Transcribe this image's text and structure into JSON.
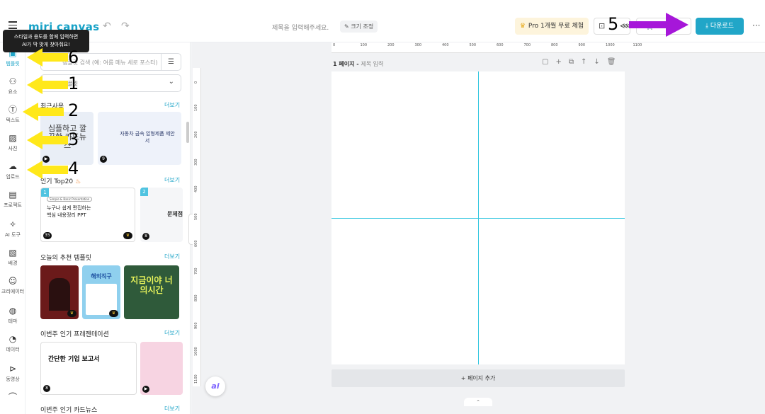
{
  "topbar": {
    "logo": "miri canvas",
    "undo_icon": "undo-icon",
    "redo_icon": "redo-icon",
    "doc_title_placeholder": "제목을 입력해주세요.",
    "resize_label": "크기 조정",
    "pro_trial_label": "Pro 1개월 무료 체험",
    "download_label": "다운로드",
    "more_label": "···"
  },
  "tooltip": {
    "line1": "스타일과 용도를 함께 입력하면",
    "line2": "AI가 딱 맞게 찾아줘요!"
  },
  "rail": {
    "items": [
      {
        "label": "템플릿",
        "icon": "template-icon"
      },
      {
        "label": "요소",
        "icon": "elements-icon"
      },
      {
        "label": "텍스트",
        "icon": "text-icon"
      },
      {
        "label": "사진",
        "icon": "photo-icon"
      },
      {
        "label": "업로드",
        "icon": "upload-icon"
      },
      {
        "label": "프로젝트",
        "icon": "project-icon"
      },
      {
        "label": "AI 도구",
        "icon": "ai-tools-icon"
      },
      {
        "label": "배경",
        "icon": "background-icon"
      },
      {
        "label": "크리에이터",
        "icon": "creator-icon"
      },
      {
        "label": "테마",
        "icon": "theme-icon"
      },
      {
        "label": "데이터",
        "icon": "data-icon"
      },
      {
        "label": "동영상",
        "icon": "video-icon"
      }
    ]
  },
  "panel": {
    "search_placeholder": "템플릿 검색 (예: 여름 메뉴 세로 포스터)",
    "select_value": "템플릿",
    "recent_title": "최근사용",
    "more_label": "더보기",
    "recent_thumbs": [
      {
        "title": "심플하고 깔끔한 카드뉴스",
        "count": ""
      },
      {
        "title": "자동차 금속 압형제품 제안서",
        "count": "9"
      }
    ],
    "top20_title": "인기 Top20",
    "top20_thumbs": [
      {
        "rank": "1",
        "tag": "Simple & Basic Presentation",
        "line1": "누구나 쉽게 편집하는",
        "line2": "핵심 내용정리 PPT",
        "count": "35"
      },
      {
        "rank": "2",
        "line1": "문제점",
        "count": "8"
      }
    ],
    "recommended_title": "오늘의 추천 템플릿",
    "recommended_thumbs": [
      {
        "text": ""
      },
      {
        "text": "해외직구"
      },
      {
        "text": "지금이야 너의시간"
      }
    ],
    "presentation_title": "이번주 인기 프레젠테이션",
    "presentation_thumbs": [
      {
        "text": "간단한 기업 보고서",
        "count": "8"
      },
      {
        "text": ""
      }
    ],
    "cardnews_title": "이번주 인기 카드뉴스"
  },
  "canvas": {
    "page_label": "1 페이지 - ",
    "page_title_placeholder": "제목 입력",
    "add_page_label": "+ 페이지 추가",
    "ai_label": "ai",
    "ruler_top": [
      "0",
      "100",
      "200",
      "300",
      "400",
      "500",
      "600",
      "700",
      "800",
      "900",
      "1000",
      "1100"
    ],
    "ruler_left": [
      "0",
      "100",
      "200",
      "300",
      "400",
      "500",
      "600",
      "700",
      "800",
      "900",
      "1000",
      "1100"
    ]
  },
  "annotations": [
    "6",
    "1",
    "2",
    "3",
    "4",
    "5"
  ],
  "colors": {
    "accent": "#21a6c8",
    "arrow_yellow": "#ffe81a",
    "arrow_purple": "#a617d9",
    "guide": "#35c7e0"
  }
}
